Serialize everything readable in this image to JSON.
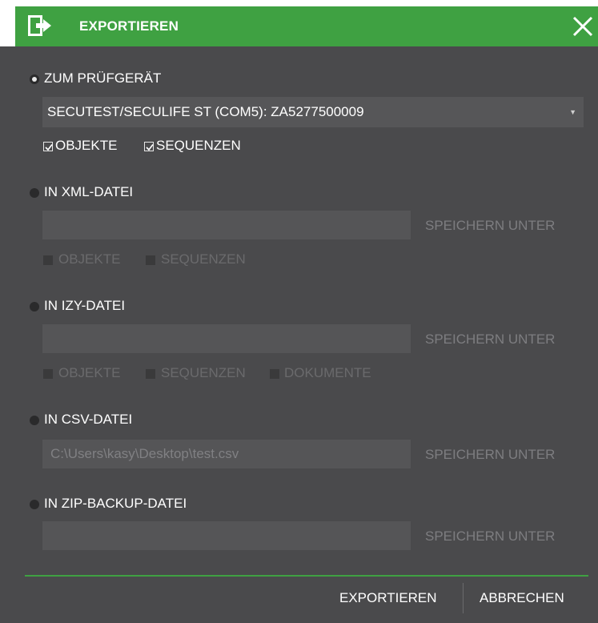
{
  "dialog": {
    "title": "EXPORTIEREN",
    "icon": "export-icon",
    "close_icon": "close-icon"
  },
  "options": [
    {
      "label": "ZUM PRÜFGERÄT",
      "selected": true,
      "device": "SECUTEST/SECULIFE ST (COM5): ZA5277500009",
      "checkboxes": [
        {
          "label": "OBJEKTE",
          "checked": true,
          "enabled": true
        },
        {
          "label": "SEQUENZEN",
          "checked": true,
          "enabled": true
        }
      ]
    },
    {
      "label": "IN XML-DATEI",
      "selected": false,
      "path": "",
      "save_as": "SPEICHERN UNTER",
      "checkboxes": [
        {
          "label": "OBJEKTE",
          "checked": false,
          "enabled": false
        },
        {
          "label": "SEQUENZEN",
          "checked": false,
          "enabled": false
        }
      ]
    },
    {
      "label": "IN IZY-DATEI",
      "selected": false,
      "path": "",
      "save_as": "SPEICHERN UNTER",
      "checkboxes": [
        {
          "label": "OBJEKTE",
          "checked": false,
          "enabled": false
        },
        {
          "label": "SEQUENZEN",
          "checked": false,
          "enabled": false
        },
        {
          "label": "DOKUMENTE",
          "checked": false,
          "enabled": false
        }
      ]
    },
    {
      "label": "IN CSV-DATEI",
      "selected": false,
      "path": "C:\\Users\\kasy\\Desktop\\test.csv",
      "save_as": "SPEICHERN UNTER"
    },
    {
      "label": "IN ZIP-BACKUP-DATEI",
      "selected": false,
      "path": "",
      "save_as": "SPEICHERN UNTER"
    }
  ],
  "footer": {
    "export_label": "EXPORTIEREN",
    "cancel_label": "ABBRECHEN"
  },
  "colors": {
    "accent": "#3fa142",
    "background": "#4a4a4c",
    "field": "#555557",
    "disabled_text": "#6a6a6c"
  }
}
